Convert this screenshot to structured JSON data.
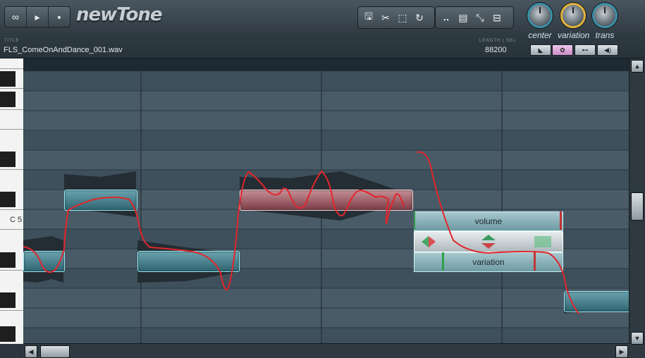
{
  "transport": {
    "loop_icon": "infinity-icon",
    "loop_label": "∞",
    "play_label": "▸",
    "stop_label": "▪"
  },
  "app": {
    "name": "newTone"
  },
  "file": {
    "title_label": "TITLE",
    "title": "FLS_ComeOnAndDance_001.wav",
    "length_label": "LENGTH | SEL",
    "length": "88200"
  },
  "toolbar_left": [
    {
      "icon": "save-icon",
      "glyph": "🖫"
    },
    {
      "icon": "cut-icon",
      "glyph": "✂"
    },
    {
      "icon": "select-icon",
      "glyph": "⬚"
    },
    {
      "icon": "undo-icon",
      "glyph": "↻"
    }
  ],
  "toolbar_right": [
    {
      "icon": "staircase-icon",
      "glyph": "⠤"
    },
    {
      "icon": "save-plus-icon",
      "glyph": "▤"
    },
    {
      "icon": "cursor-slice-icon",
      "glyph": "⤡"
    },
    {
      "icon": "resize-icon",
      "glyph": "⊟"
    }
  ],
  "knobs": [
    {
      "label": "center",
      "level": 0.5
    },
    {
      "label": "variation",
      "level": 0.3
    },
    {
      "label": "trans",
      "level": 0.5
    }
  ],
  "mode_buttons": [
    {
      "icon": "slice-mode-icon",
      "glyph": "◣"
    },
    {
      "icon": "pitch-mode-icon",
      "glyph": "✿"
    },
    {
      "icon": "link-mode-icon",
      "glyph": "⊷"
    },
    {
      "icon": "audio-mode-icon",
      "glyph": "◀)"
    }
  ],
  "piano": {
    "c5_label": "C 5"
  },
  "note_controls": {
    "top_label": "volume",
    "bottom_label": "variation"
  },
  "scroll": {
    "up": "▲",
    "down": "▼",
    "left": "◀",
    "right": "▶"
  },
  "colors": {
    "accent": "#3a8fa8",
    "pitch_curve": "#e2262c",
    "note": "#4f8c98",
    "selected_note": "#a9646c"
  }
}
